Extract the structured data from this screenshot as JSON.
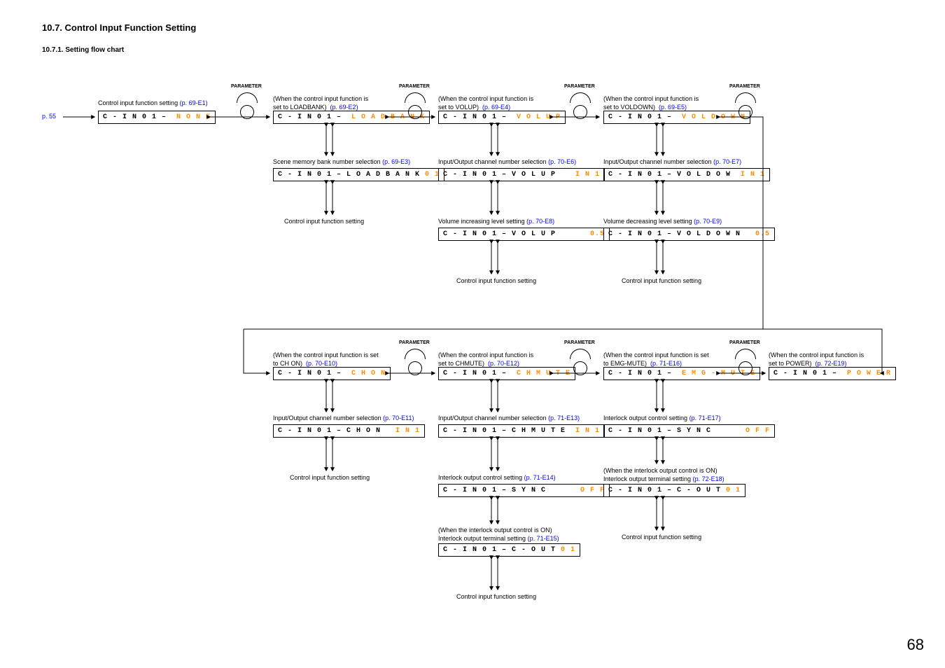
{
  "heading": "10.7. Control Input Function Setting",
  "subheading": "10.7.1. Setting flow chart",
  "p55": "p. 55",
  "pagenum": "68",
  "param": "PARAMETER",
  "top": {
    "none": {
      "t": "Control input function setting",
      "r": "(p. 69-E1)",
      "d": {
        "p": "C - I N 0 1 –",
        "v": "N O N E"
      }
    },
    "loadbank": {
      "t": "(When the control input function is set to LOADBANK)",
      "r": "(p. 69-E2)",
      "d": {
        "p": "C - I N 0 1 –",
        "v": "L O A D B A N K"
      },
      "s1": {
        "t": "Scene memory bank number selection",
        "r": "(p. 69-E3)",
        "d": {
          "p": "C - I N 0 1 – L O A D B A N K",
          "v": "0 1"
        }
      },
      "s2": {
        "t": "Control input function setting"
      }
    },
    "volup": {
      "t": "(When the control input function is set to VOLUP)",
      "r": "(p. 69-E4)",
      "d": {
        "p": "C - I N 0 1 –",
        "v": "V O L U P"
      },
      "s1": {
        "t": "Input/Output channel number selection",
        "r": "(p. 70-E6)",
        "d": {
          "p": "C - I N 0 1 – V O L U P",
          "v": "I N 1"
        }
      },
      "s2": {
        "t": "Volume increasing level setting",
        "r": "(p. 70-E8)",
        "d": {
          "p": "C - I N 0 1 – V O L U P",
          "v": "0.5"
        }
      },
      "s3": {
        "t": "Control input function setting"
      }
    },
    "voldown": {
      "t": "(When the control input function is set to VOLDOWN)",
      "r": "(p. 69-E5)",
      "d": {
        "p": "C - I N 0 1 –",
        "v": "V O L D O W N"
      },
      "s1": {
        "t": "Input/Output channel number selection",
        "r": "(p. 70-E7)",
        "d": {
          "p": "C - I N 0 1 – V O L D O W",
          "v": "I N 1"
        }
      },
      "s2": {
        "t": "Volume decreasing level setting",
        "r": "(p. 70-E9)",
        "d": {
          "p": "C - I N 0 1 – V O L D O W N",
          "v": "0.5"
        }
      },
      "s3": {
        "t": "Control input function setting"
      }
    }
  },
  "bot": {
    "chon": {
      "t": "(When the control input function is set to CH ON)",
      "r": "(p. 70-E10)",
      "d": {
        "p": "C - I N 0 1 –",
        "v": "C H   O N"
      },
      "s1": {
        "t": "Input/Output channel number selection",
        "r": "(p. 70-E11)",
        "d": {
          "p": "C - I N 0 1 – C H   O N",
          "v": "I N 1"
        }
      },
      "s2": {
        "t": "Control input function setting"
      }
    },
    "chmute": {
      "t": "(When the control input function is set to CHMUTE)",
      "r": "(p. 70-E12)",
      "d": {
        "p": "C - I N 0 1 –",
        "v": "C H M U T E"
      },
      "s1": {
        "t": "Input/Output channel number selection",
        "r": "(p. 71-E13)",
        "d": {
          "p": "C - I N 0 1 – C H M U T E",
          "v": "I N 1"
        }
      },
      "s2": {
        "t": "Interlock output control setting",
        "r": "(p. 71-E14)",
        "d": {
          "p": "C - I N 0 1 – S Y N C",
          "v": "O F F"
        }
      },
      "s3": {
        "t": "(When the interlock output control is ON) Interlock output terminal setting",
        "r": "(p. 71-E15)",
        "d": {
          "p": "C - I N 0 1 – C - O U T",
          "v": "0 1"
        }
      },
      "s4": {
        "t": "Control input function setting"
      }
    },
    "emg": {
      "t": "(When the control input function is set to EMG-MUTE)",
      "r": "(p. 71-E16)",
      "d": {
        "p": "C - I N 0 1 –",
        "v": "E M G - M U T E"
      },
      "s1": {
        "t": "Interlock output control setting",
        "r": "(p. 71-E17)",
        "d": {
          "p": "C - I N 0 1 – S Y N C",
          "v": "O F F"
        }
      },
      "s2": {
        "t": "(When the interlock output control is ON) Interlock output terminal setting",
        "r": "(p. 72-E18)",
        "d": {
          "p": "C - I N 0 1 – C - O U T",
          "v": "0 1"
        }
      },
      "s3": {
        "t": "Control input function setting"
      }
    },
    "power": {
      "t": "(When the control input function is set to POWER)",
      "r": "(p. 72-E19)",
      "d": {
        "p": "C - I N 0 1 –",
        "v": "P O W E R"
      }
    }
  }
}
